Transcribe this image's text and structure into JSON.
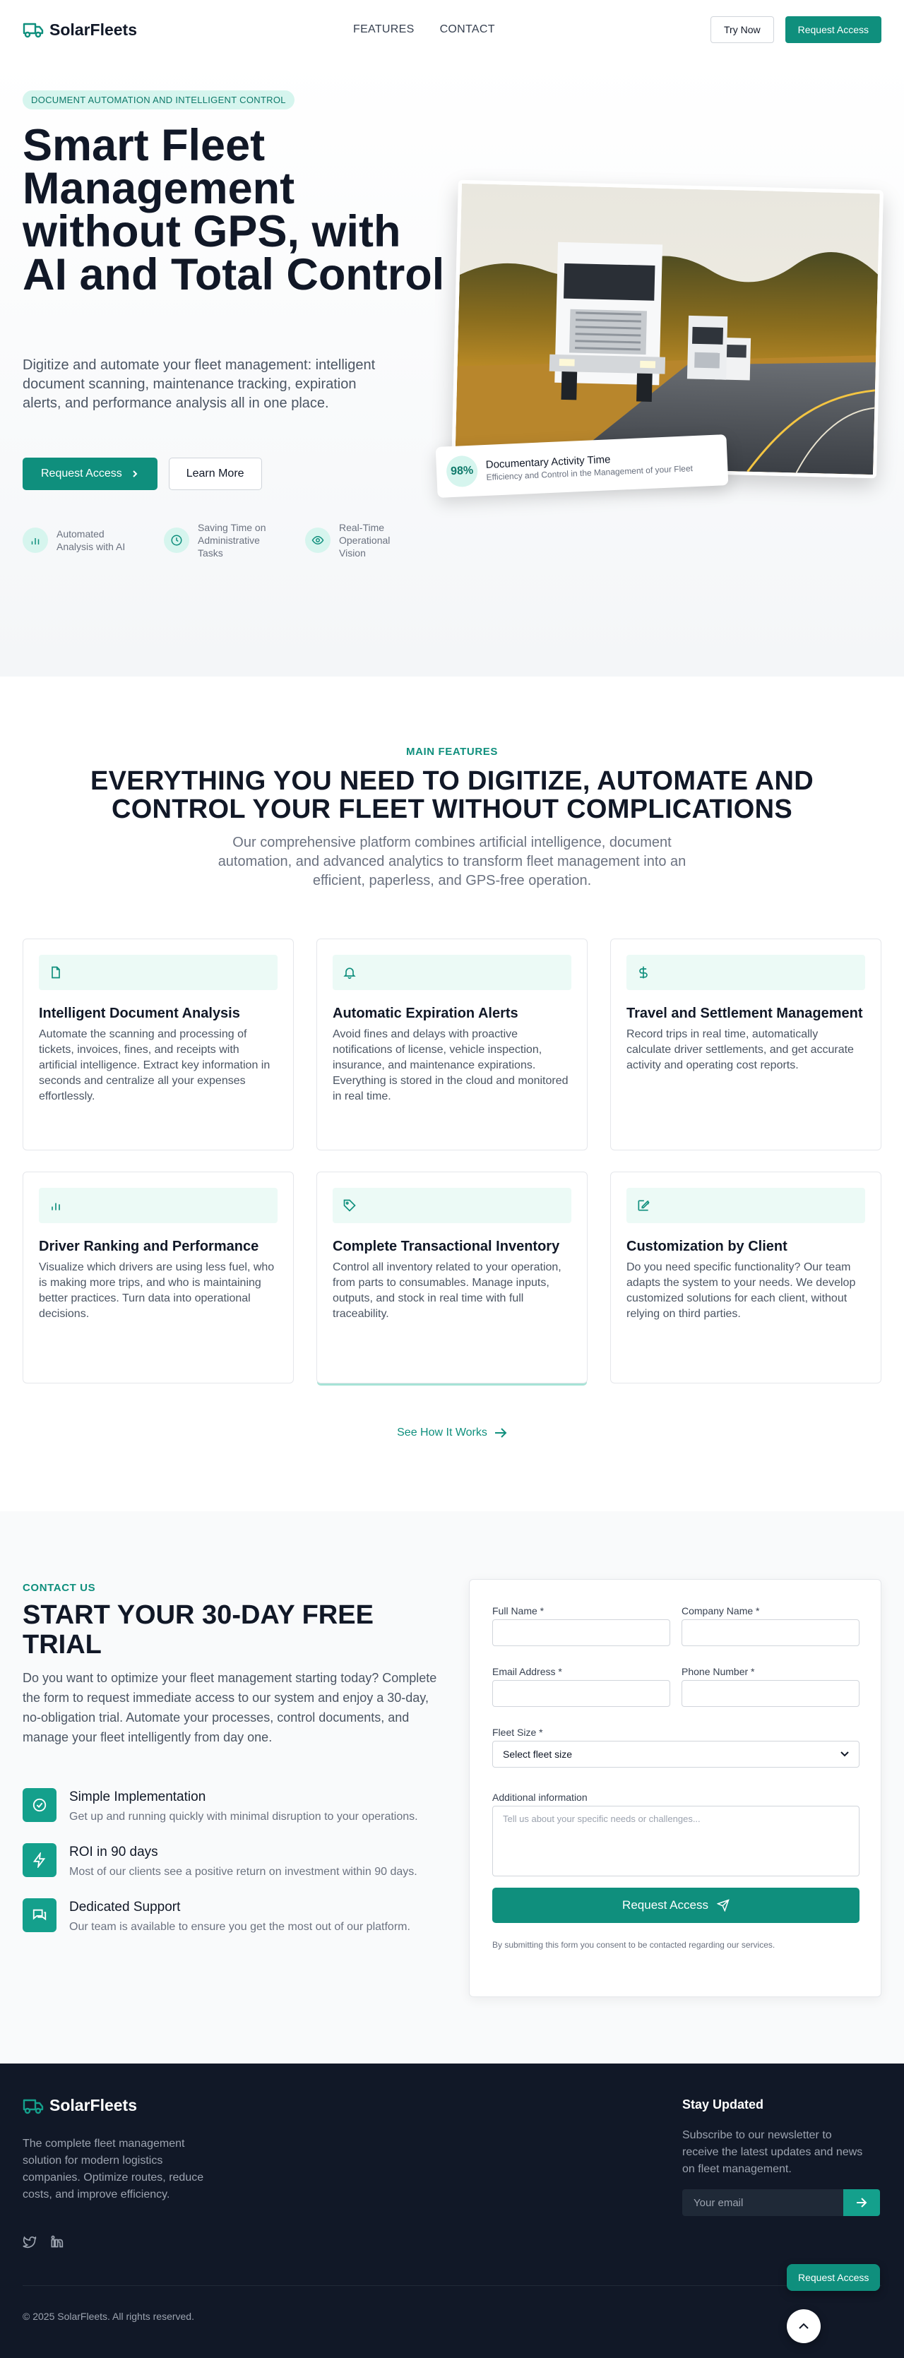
{
  "nav": {
    "brand": "SolarFleets",
    "links": [
      "FEATURES",
      "CONTACT"
    ],
    "try_now": "Try Now",
    "request_access": "Request Access"
  },
  "hero": {
    "badge": "DOCUMENT AUTOMATION AND INTELLIGENT CONTROL",
    "title": "Smart Fleet Management without GPS, with AI and Total Control",
    "description": "Digitize and automate your fleet management: intelligent document scanning, maintenance tracking, expiration alerts, and performance analysis all in one place.",
    "primary_cta": "Request Access",
    "secondary_cta": "Learn More",
    "features": [
      {
        "icon": "bar-chart-icon",
        "label": "Automated Analysis with AI"
      },
      {
        "icon": "clock-icon",
        "label": "Saving Time on Administrative Tasks"
      },
      {
        "icon": "eye-icon",
        "label": "Real-Time Operational Vision"
      }
    ],
    "stat": {
      "value": "98%",
      "title": "Documentary Activity Time",
      "subtitle": "Efficiency and Control in the Management of your Fleet"
    }
  },
  "features": {
    "eyebrow": "MAIN FEATURES",
    "title": "EVERYTHING YOU NEED TO DIGITIZE, AUTOMATE AND CONTROL YOUR FLEET WITHOUT COMPLICATIONS",
    "description": "Our comprehensive platform combines artificial intelligence, document automation, and advanced analytics to transform fleet management into an efficient, paperless, and GPS-free operation.",
    "cards": [
      {
        "icon": "file-icon",
        "title": "Intelligent Document Analysis",
        "text": "Automate the scanning and processing of tickets, invoices, fines, and receipts with artificial intelligence. Extract key information in seconds and centralize all your expenses effortlessly."
      },
      {
        "icon": "bell-icon",
        "title": "Automatic Expiration Alerts",
        "text": "Avoid fines and delays with proactive notifications of license, vehicle inspection, insurance, and maintenance expirations. Everything is stored in the cloud and monitored in real time."
      },
      {
        "icon": "dollar-icon",
        "title": "Travel and Settlement Management",
        "text": "Record trips in real time, automatically calculate driver settlements, and get accurate activity and operating cost reports."
      },
      {
        "icon": "bar-chart-icon",
        "title": "Driver Ranking and Performance",
        "text": "Visualize which drivers are using less fuel, who is making more trips, and who is maintaining better practices. Turn data into operational decisions."
      },
      {
        "icon": "tag-icon",
        "title": "Complete Transactional Inventory",
        "text": "Control all inventory related to your operation, from parts to consumables. Manage inputs, outputs, and stock in real time with full traceability."
      },
      {
        "icon": "edit-icon",
        "title": "Customization by Client",
        "text": "Do you need specific functionality? Our team adapts the system to your needs. We develop customized solutions for each client, without relying on third parties."
      }
    ],
    "see_how": "See How It Works"
  },
  "contact": {
    "eyebrow": "CONTACT US",
    "title": "START YOUR 30-DAY FREE TRIAL",
    "description": "Do you want to optimize your fleet management starting today? Complete the form to request immediate access to our system and enjoy a 30-day, no-obligation trial. Automate your processes, control documents, and manage your fleet intelligently from day one.",
    "items": [
      {
        "icon": "check-circle-icon",
        "title": "Simple Implementation",
        "text": "Get up and running quickly with minimal disruption to your operations."
      },
      {
        "icon": "lightning-icon",
        "title": "ROI in 90 days",
        "text": "Most of our clients see a positive return on investment within 90 days."
      },
      {
        "icon": "chat-icon",
        "title": "Dedicated Support",
        "text": "Our team is available to ensure you get the most out of our platform."
      }
    ],
    "form": {
      "full_name_label": "Full Name *",
      "company_label": "Company Name *",
      "email_label": "Email Address *",
      "phone_label": "Phone Number *",
      "fleet_size_label": "Fleet Size *",
      "fleet_size_value": "Select fleet size",
      "additional_label": "Additional information",
      "additional_placeholder": "Tell us about your specific needs or challenges...",
      "submit": "Request Access",
      "note": "By submitting this form you consent to be contacted regarding our services."
    }
  },
  "footer": {
    "brand": "SolarFleets",
    "description": "The complete fleet management solution for modern logistics companies. Optimize routes, reduce costs, and improve efficiency.",
    "newsletter_title": "Stay Updated",
    "newsletter_desc": "Subscribe to our newsletter to receive the latest updates and news on fleet management.",
    "email_placeholder": "Your email",
    "copyright": "© 2025 SolarFleets. All rights reserved.",
    "float_request": "Request Access"
  },
  "colors": {
    "accent": "#0f8f7d",
    "accent_light": "#d6f5ee",
    "footer_bg": "#111827"
  }
}
